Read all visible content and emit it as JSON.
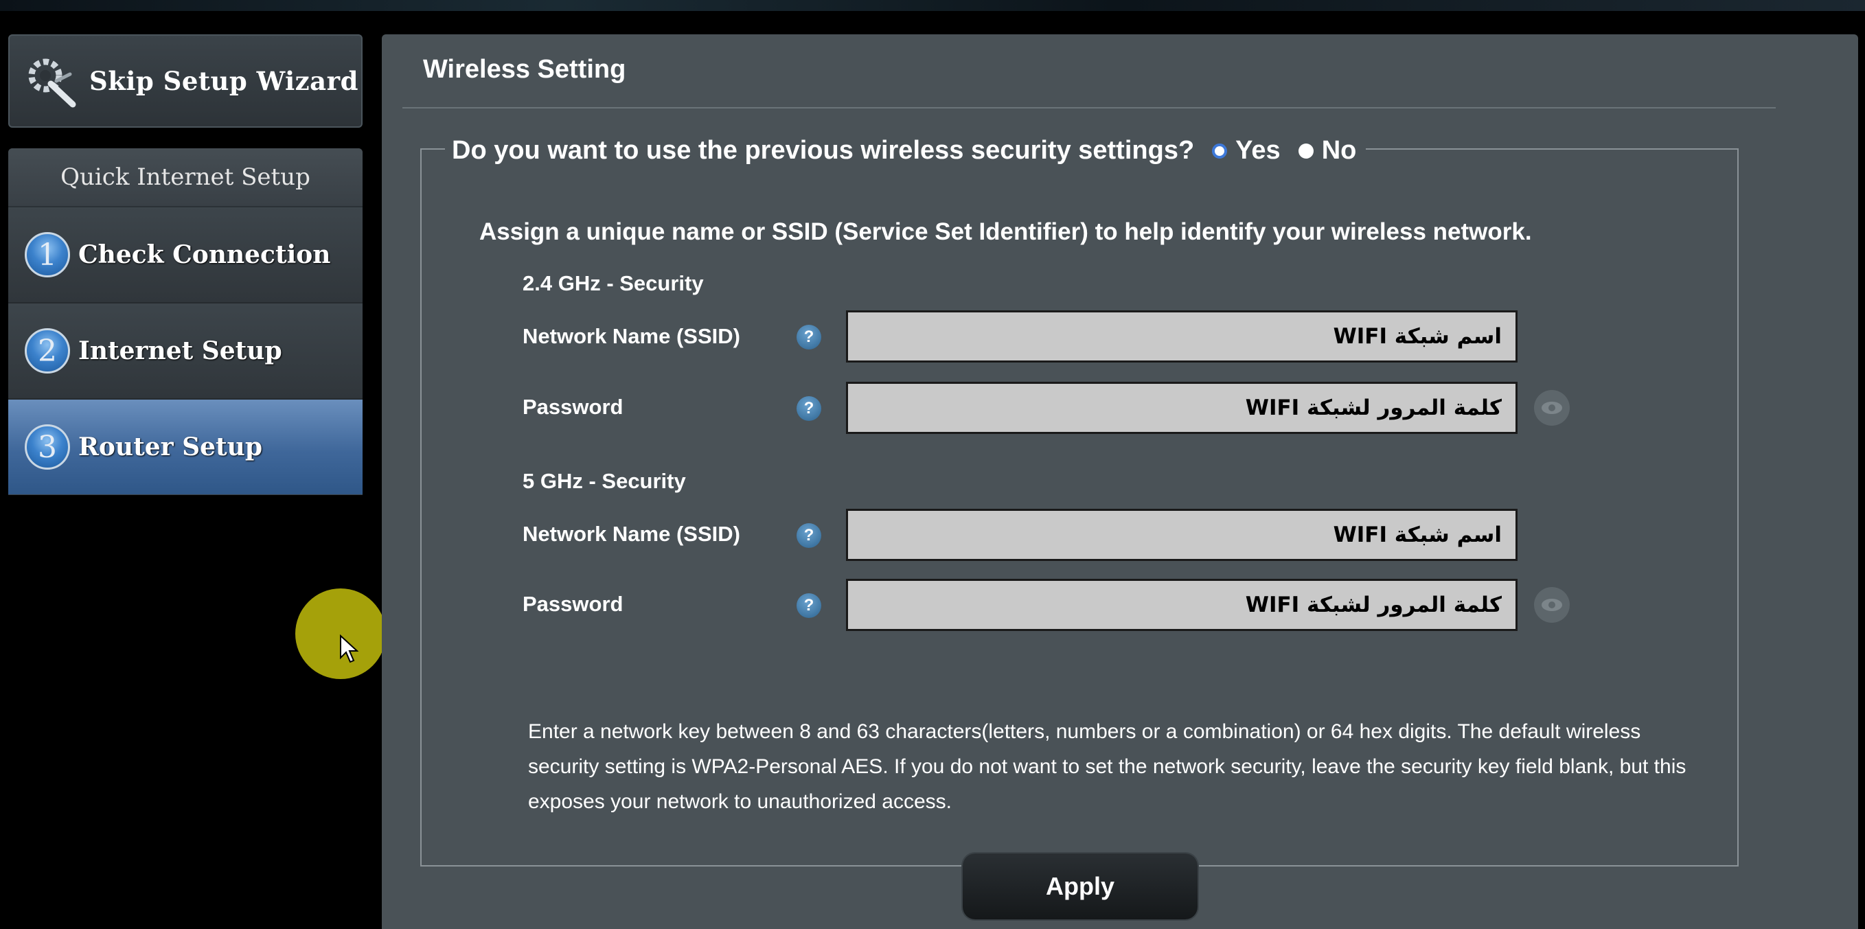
{
  "sidebar": {
    "skip_label": "Skip Setup Wizard",
    "qis_title": "Quick Internet Setup",
    "steps": [
      {
        "num": "1",
        "label": "Check Connection",
        "active": false
      },
      {
        "num": "2",
        "label": "Internet Setup",
        "active": false
      },
      {
        "num": "3",
        "label": "Router Setup",
        "active": true
      }
    ]
  },
  "main": {
    "title": "Wireless Setting",
    "question": "Do you want to use the previous wireless security settings?",
    "options": {
      "yes": "Yes",
      "no": "No",
      "selected": "yes"
    },
    "assign_text": "Assign a unique name or SSID (Service Set Identifier) to help identify your wireless network.",
    "band_24": {
      "title": "2.4 GHz - Security",
      "ssid_label": "Network Name (SSID)",
      "ssid_value": "اسم شبكة WIFI",
      "password_label": "Password",
      "password_value": "كلمة المرور لشبكة WIFI"
    },
    "band_5": {
      "title": "5 GHz - Security",
      "ssid_label": "Network Name (SSID)",
      "ssid_value": "اسم شبكة WIFI",
      "password_label": "Password",
      "password_value": "كلمة المرور لشبكة WIFI"
    },
    "help_glyph": "?",
    "note": "Enter a network key between 8 and 63 characters(letters, numbers or a combination) or 64 hex digits. The default wireless security setting is WPA2-Personal AES. If you do not want to set the network security, leave the security key field blank, but this exposes your network to unauthorized access.",
    "apply_label": "Apply"
  },
  "colors": {
    "panel_bg": "#4a5257",
    "active_step": "#3f679a",
    "radio_selected": "#3d78d8",
    "cursor_highlight": "#a5a10a"
  }
}
